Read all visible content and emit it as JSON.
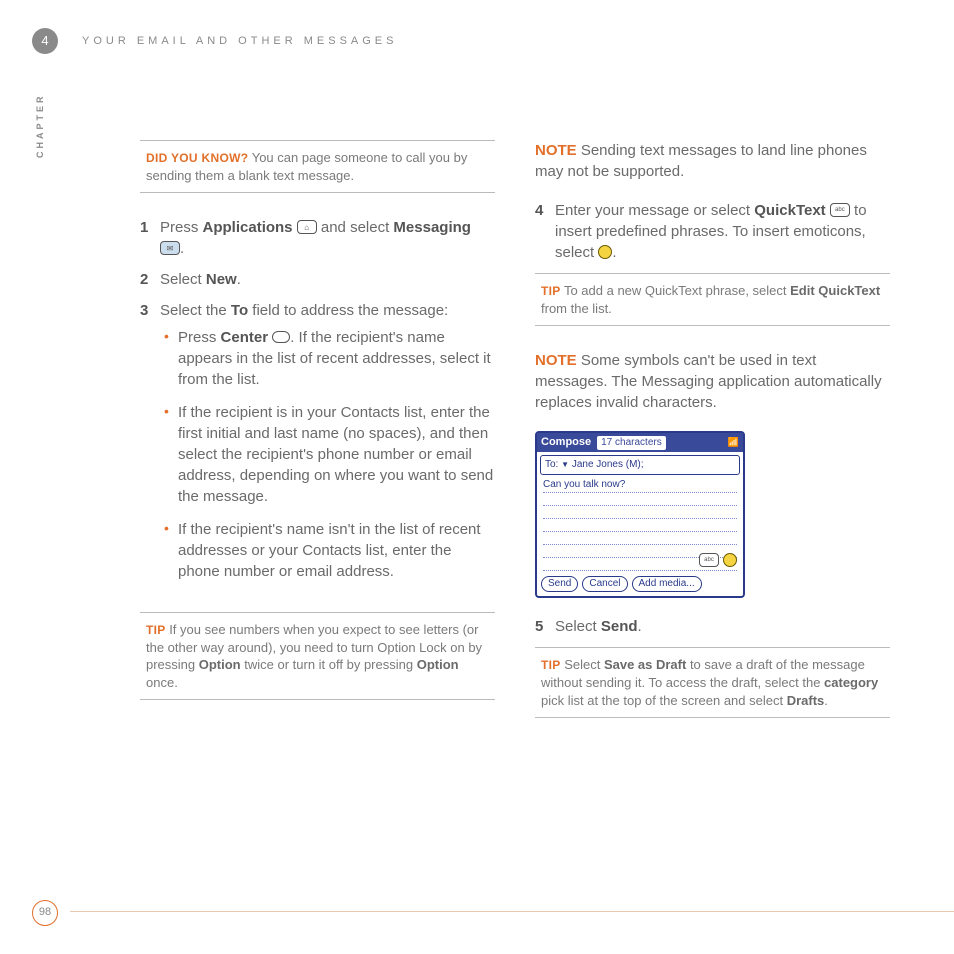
{
  "header": {
    "chapterNum": "4",
    "runningHead": "YOUR EMAIL AND OTHER MESSAGES",
    "sideLabel": "CHAPTER"
  },
  "left": {
    "didYouKnow": {
      "lead": "DID YOU KNOW?",
      "text": " You can page someone to call you by sending them a blank text message."
    },
    "steps": {
      "s1": {
        "num": "1",
        "pre": "Press ",
        "b1": "Applications",
        "mid": " and select ",
        "b2": "Messaging",
        "post": "."
      },
      "s2": {
        "num": "2",
        "pre": "Select ",
        "b1": "New",
        "post": "."
      },
      "s3": {
        "num": "3",
        "pre": "Select the ",
        "b1": "To",
        "post": " field to address the message:"
      }
    },
    "bullets": {
      "b1": {
        "pre": "Press ",
        "bold": "Center",
        "post": ". If the recipient's name appears in the list of recent addresses, select it from the list."
      },
      "b2": "If the recipient is in your Contacts list, enter the first initial and last name (no spaces), and then select the recipient's phone number or email address, depending on where you want to send the message.",
      "b3": "If the recipient's name isn't in the list of recent addresses or your Contacts list, enter the phone number or email address."
    },
    "tip": {
      "lead": "TIP",
      "t1": " If you see numbers when you expect to see letters (or the other way around), you need to turn Option Lock on by pressing ",
      "b1": "Option",
      "t2": " twice or turn it off by pressing ",
      "b2": "Option",
      "t3": " once."
    }
  },
  "right": {
    "note1": {
      "lead": "NOTE",
      "text": " Sending text messages to land line phones may not be supported."
    },
    "step4": {
      "num": "4",
      "t1": "Enter your message or select ",
      "b1": "QuickText",
      "t2": " to insert predefined phrases. To insert emoticons, select ",
      "t3": "."
    },
    "tipQT": {
      "lead": "TIP",
      "t1": " To add a new QuickText phrase, select ",
      "b1": "Edit QuickText",
      "t2": " from the list."
    },
    "note2": {
      "lead": "NOTE",
      "text": " Some symbols can't be used in text messages. The Messaging application automatically replaces invalid characters."
    },
    "compose": {
      "title": "Compose",
      "chars": "17 characters",
      "toLabel": "To:",
      "toName": "Jane Jones (M);",
      "msg": "Can you talk now?",
      "btnSend": "Send",
      "btnCancel": "Cancel",
      "btnAdd": "Add media..."
    },
    "step5": {
      "num": "5",
      "pre": "Select ",
      "b1": "Send",
      "post": "."
    },
    "tipDraft": {
      "lead": "TIP",
      "t1": " Select ",
      "b1": "Save as Draft",
      "t2": " to save a draft of the message without sending it. To access the draft, select the ",
      "b2": "category",
      "t3": " pick list at the top of the screen and select ",
      "b3": "Drafts",
      "t4": "."
    }
  },
  "pageNum": "98"
}
